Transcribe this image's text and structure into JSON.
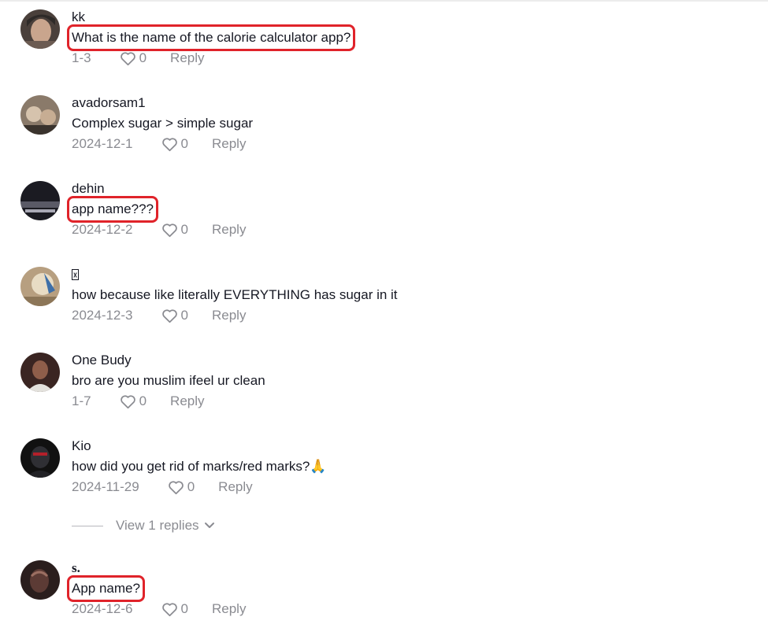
{
  "comments": [
    {
      "username": "kk",
      "text": "What is the name of the calorie calculator app?",
      "date": "1-3",
      "likes": "0",
      "reply_label": "Reply",
      "highlighted": true,
      "avatar_colors": [
        "#6b5b52",
        "#c9a58d",
        "#2e2a28"
      ]
    },
    {
      "username": "avadorsam1",
      "text": "Complex sugar > simple sugar",
      "date": "2024-12-1",
      "likes": "0",
      "reply_label": "Reply",
      "highlighted": false,
      "avatar_colors": [
        "#8a7a6a",
        "#d6c3ad",
        "#3a332d"
      ]
    },
    {
      "username": "dehin",
      "text": "app name???",
      "date": "2024-12-2",
      "likes": "0",
      "reply_label": "Reply",
      "highlighted": true,
      "avatar_colors": [
        "#1b1b22",
        "#5a5a66",
        "#a9a9b5"
      ]
    },
    {
      "username": "",
      "text": "how because like literally EVERYTHING has sugar in it",
      "date": "2024-12-3",
      "likes": "0",
      "reply_label": "Reply",
      "highlighted": false,
      "avatar_colors": [
        "#b79f80",
        "#e8dcc4",
        "#3e6fa8"
      ]
    },
    {
      "username": "One Budy",
      "text": "bro are you muslim ifeel ur clean",
      "date": "1-7",
      "likes": "0",
      "reply_label": "Reply",
      "highlighted": false,
      "avatar_colors": [
        "#3a2522",
        "#8f5e4a",
        "#e3e1dc"
      ]
    },
    {
      "username": "Kio",
      "text": "how did you get rid of marks/red marks?🙏",
      "date": "2024-11-29",
      "likes": "0",
      "reply_label": "Reply",
      "highlighted": false,
      "avatar_colors": [
        "#111111",
        "#2f2f34",
        "#b3202a"
      ]
    },
    {
      "username": "s.",
      "text": "App name?",
      "date": "2024-12-6",
      "likes": "0",
      "reply_label": "Reply",
      "highlighted": true,
      "avatar_colors": [
        "#2a1e1d",
        "#5c3b35",
        "#9b6f62"
      ]
    }
  ],
  "view_replies": {
    "label": "View 1 replies"
  },
  "colors": {
    "highlight": "#e0232a",
    "muted": "#8a8b91",
    "text": "#161823"
  },
  "icons": {
    "like": "heart-outline-icon",
    "expand": "chevron-down-icon"
  }
}
